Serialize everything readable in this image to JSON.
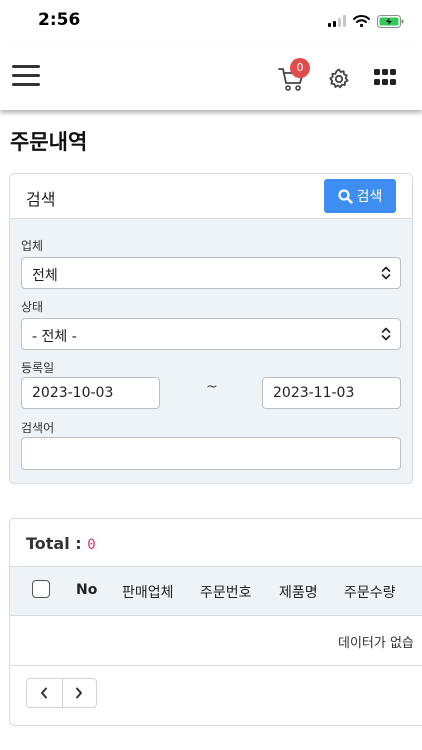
{
  "status_bar": {
    "time": "2:56"
  },
  "header": {
    "cart_count": "0",
    "icons": [
      "hamburger-menu-icon",
      "cart-icon",
      "gear-icon",
      "apps-grid-icon"
    ],
    "badge_color": "#e04b4b"
  },
  "page": {
    "title": "주문내역"
  },
  "search": {
    "title": "검색",
    "button_label": "검색",
    "accent": "#3d8ef0",
    "fields": {
      "vendor_label": "업체",
      "vendor_value": "전체",
      "status_label": "상태",
      "status_value": "- 전체 -",
      "date_label": "등록일",
      "date_from": "2023-10-03",
      "date_separator": "~",
      "date_to": "2023-11-03",
      "keyword_label": "검색어",
      "keyword_value": ""
    }
  },
  "results": {
    "total_label": "Total :",
    "total_count": "0",
    "columns": [
      "No",
      "판매업체",
      "주문번호",
      "제품명",
      "주문수량"
    ],
    "empty_message": "데이터가 없습"
  }
}
